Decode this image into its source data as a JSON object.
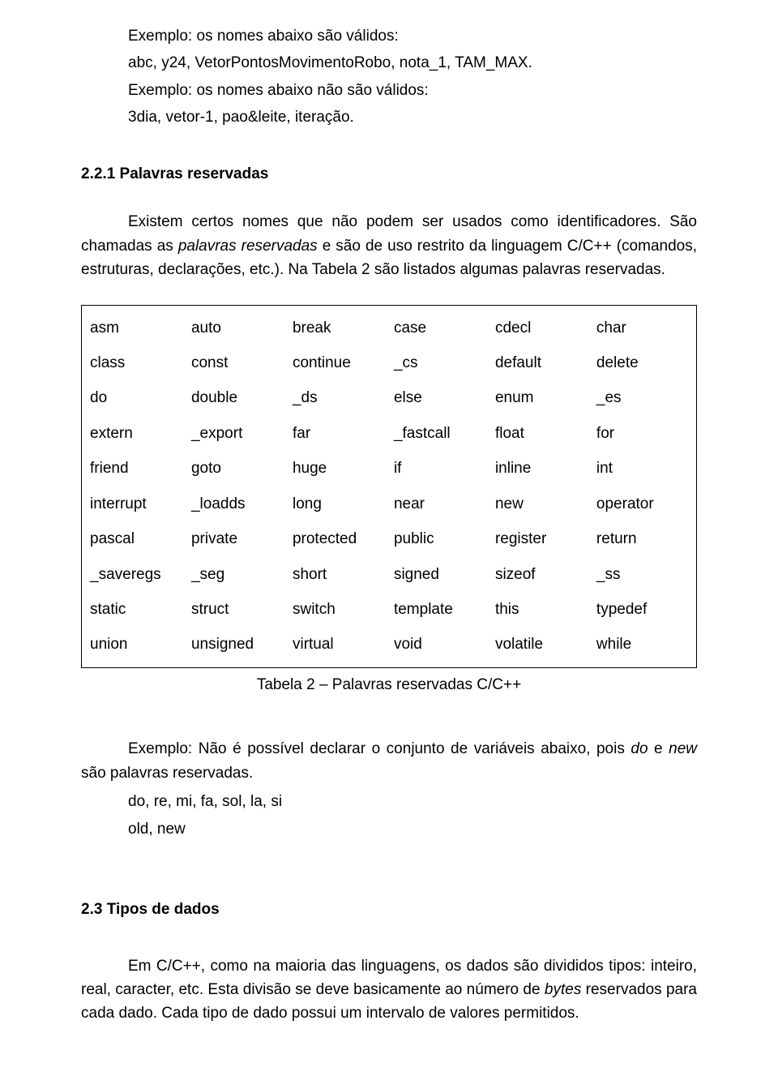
{
  "intro": {
    "line1": "Exemplo: os nomes abaixo são válidos:",
    "line2": "abc, y24, VetorPontosMovimentoRobo, nota_1, TAM_MAX.",
    "line3": "Exemplo: os nomes abaixo não são válidos:",
    "line4": "3dia, vetor-1, pao&leite, iteração."
  },
  "section221": {
    "heading": "2.2.1   Palavras reservadas",
    "para_pre": "Existem certos nomes que não podem ser usados como identificadores. São chamadas as ",
    "para_italic": "palavras reservadas",
    "para_post": " e são de uso restrito da linguagem C/C++ (comandos, estruturas, declarações, etc.). Na Tabela 2 são listados algumas palavras reservadas."
  },
  "keywords": [
    [
      "asm",
      "auto",
      "break",
      "case",
      "cdecl",
      "char"
    ],
    [
      "class",
      "const",
      "continue",
      "_cs",
      "default",
      "delete"
    ],
    [
      "do",
      "double",
      "_ds",
      "else",
      "enum",
      "_es"
    ],
    [
      "extern",
      "_export",
      "far",
      "_fastcall",
      "float",
      "for"
    ],
    [
      "friend",
      "goto",
      "huge",
      "if",
      "inline",
      "int"
    ],
    [
      "interrupt",
      "_loadds",
      "long",
      "near",
      "new",
      "operator"
    ],
    [
      "pascal",
      "private",
      "protected",
      "public",
      "register",
      "return"
    ],
    [
      "_saveregs",
      "_seg",
      "short",
      "signed",
      "sizeof",
      "_ss"
    ],
    [
      "static",
      "struct",
      "switch",
      "template",
      "this",
      "typedef"
    ],
    [
      "union",
      "unsigned",
      "virtual",
      "void",
      "volatile",
      "while"
    ]
  ],
  "table_caption": "Tabela 2 – Palavras reservadas C/C++",
  "example2": {
    "pre": "Exemplo: Não é possível declarar o conjunto de variáveis abaixo, pois ",
    "italic1": "do",
    "mid": " e ",
    "italic2": "new",
    "post": " são palavras reservadas.",
    "line_a": "do, re, mi, fa, sol, la, si",
    "line_b": "old, new"
  },
  "section23": {
    "heading": "2.3 Tipos de dados",
    "para_pre": "Em C/C++, como na maioria das linguagens, os dados são divididos tipos: inteiro, real, caracter, etc. Esta divisão se deve basicamente ao número de ",
    "para_italic": "bytes",
    "para_post": " reservados para cada dado. Cada tipo de dado possui um intervalo de valores permitidos."
  }
}
